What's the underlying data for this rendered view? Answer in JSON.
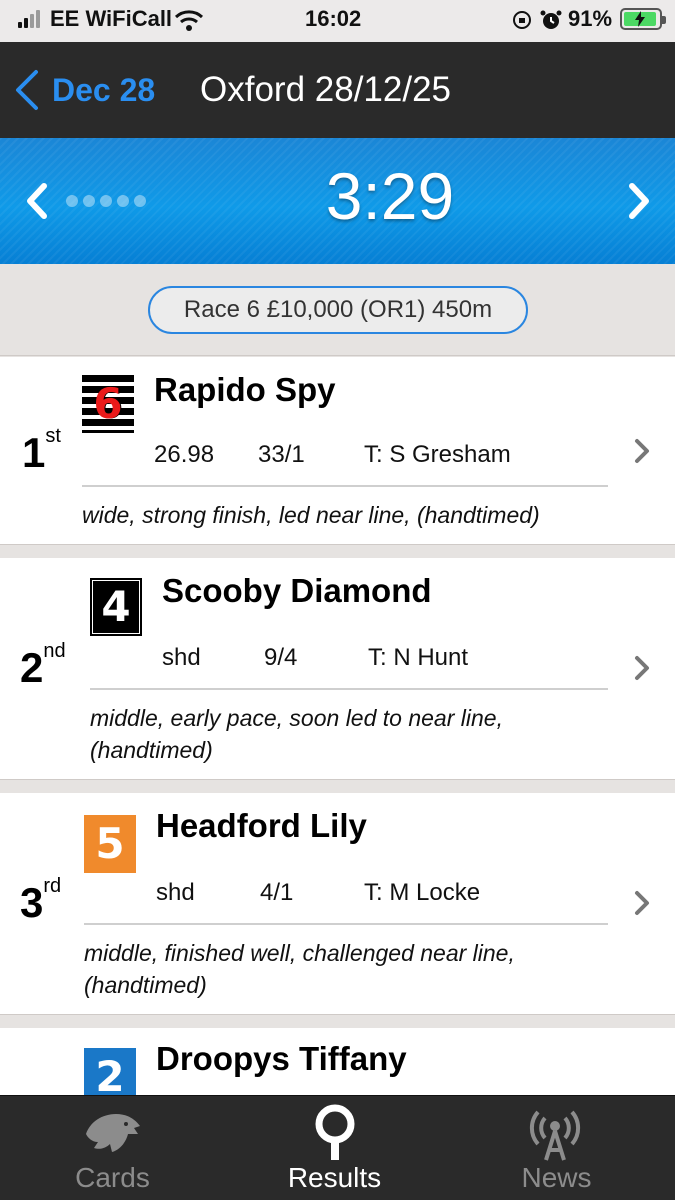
{
  "status_bar": {
    "carrier": "EE WiFiCall",
    "time": "16:02",
    "battery": "91%",
    "battery_level": 0.91,
    "icons": [
      "signal-icon",
      "wifi-icon",
      "orientation-lock-icon",
      "alarm-icon",
      "battery-charging-icon"
    ]
  },
  "nav": {
    "back_label": "Dec 28",
    "title": "Oxford 28/12/25"
  },
  "race_header": {
    "time": "3:29"
  },
  "race_info": "Race 6 £10,000 (OR1) 450m",
  "runners": [
    {
      "position": "1",
      "suffix": "st",
      "trap": "6",
      "name": "Rapido Spy",
      "time_or_distance": "26.98",
      "odds": "33/1",
      "trainer": "T: S Gresham",
      "comment": "wide, strong finish, led near line, (handtimed)"
    },
    {
      "position": "2",
      "suffix": "nd",
      "trap": "4",
      "name": "Scooby Diamond",
      "time_or_distance": "shd",
      "odds": "9/4",
      "trainer": "T: N Hunt",
      "comment_line1": "middle, early pace, soon led to near line,",
      "comment_line2": "(handtimed)"
    },
    {
      "position": "3",
      "suffix": "rd",
      "trap": "5",
      "name": "Headford Lily",
      "time_or_distance": "shd",
      "odds": "4/1",
      "trainer": "T: M Locke",
      "comment_line1": "middle, finished well, challenged near line,",
      "comment_line2": "(handtimed)"
    },
    {
      "trap": "2",
      "name": "Droopys Tiffany"
    }
  ],
  "tabs": [
    {
      "label": "Cards",
      "icon": "greyhound-icon",
      "active": false
    },
    {
      "label": "Results",
      "icon": "results-icon",
      "active": true
    },
    {
      "label": "News",
      "icon": "broadcast-icon",
      "active": false
    }
  ],
  "colors": {
    "accent": "#2a8ef0",
    "header_blue": "#0f9ae8",
    "bar_dark": "#2a2a2a",
    "trap6_red": "#ea1a1a",
    "trap5_orange": "#f08a2c",
    "trap2_blue": "#1a78c8"
  }
}
